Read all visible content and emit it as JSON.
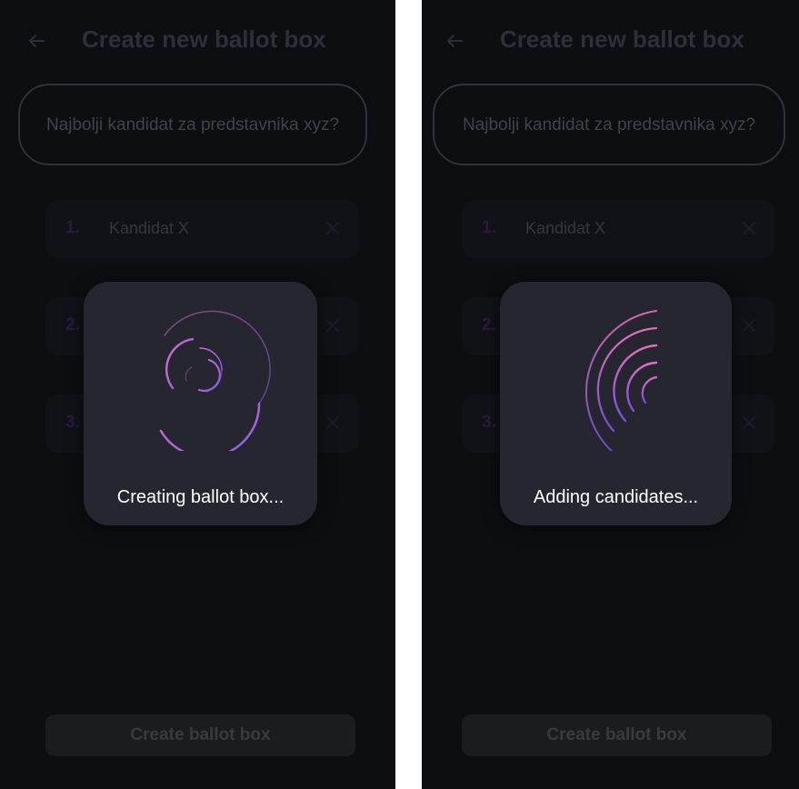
{
  "screens": [
    {
      "header": {
        "title": "Create new ballot box"
      },
      "question": "Najbolji kandidat za predstavnika xyz?",
      "candidates": [
        {
          "num": "1.",
          "name": "Kandidat X"
        },
        {
          "num": "2.",
          "name": ""
        },
        {
          "num": "3.",
          "name": ""
        }
      ],
      "create_button": "Create ballot box",
      "overlay": {
        "message": "Creating ballot box...",
        "spinner": "concentric-arcs-spinner"
      }
    },
    {
      "header": {
        "title": "Create new ballot box"
      },
      "question": "Najbolji kandidat za predstavnika xyz?",
      "candidates": [
        {
          "num": "1.",
          "name": "Kandidat X"
        },
        {
          "num": "2.",
          "name": ""
        },
        {
          "num": "3.",
          "name": ""
        }
      ],
      "create_button": "Create ballot box",
      "overlay": {
        "message": "Adding candidates...",
        "spinner": "quarter-arcs-spinner"
      }
    }
  ],
  "colors": {
    "background": "#0d0e11",
    "card": "#25262f",
    "accent_purple": "#8a5cf0",
    "accent_pink": "#d05fbf"
  }
}
